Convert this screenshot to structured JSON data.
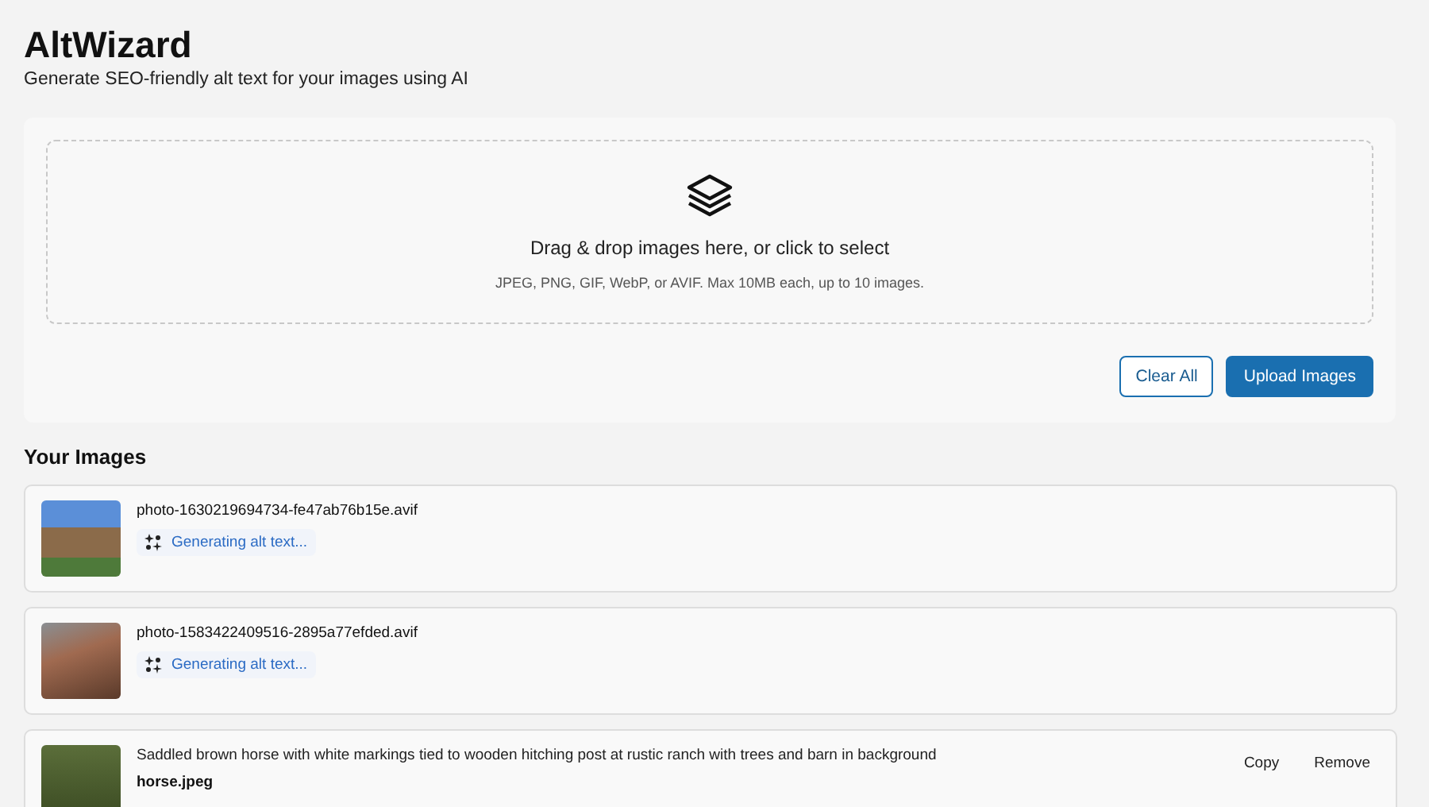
{
  "header": {
    "title": "AltWizard",
    "subtitle": "Generate SEO-friendly alt text for your images using AI"
  },
  "dropzone": {
    "heading": "Drag & drop images here, or click to select",
    "hint": "JPEG, PNG, GIF, WebP, or AVIF. Max 10MB each, up to 10 images."
  },
  "actions": {
    "clear": "Clear All",
    "upload": "Upload Images"
  },
  "images_section": {
    "title": "Your Images",
    "items": [
      {
        "kind": "pending",
        "filename": "photo-1630219694734-fe47ab76b15e.avif",
        "status": "Generating alt text..."
      },
      {
        "kind": "pending",
        "filename": "photo-1583422409516-2895a77efded.avif",
        "status": "Generating alt text..."
      },
      {
        "kind": "done",
        "alt_text": "Saddled brown horse with white markings tied to wooden hitching post at rustic ranch with trees and barn in background",
        "filename": "horse.jpeg",
        "copy": "Copy",
        "remove": "Remove"
      }
    ]
  }
}
